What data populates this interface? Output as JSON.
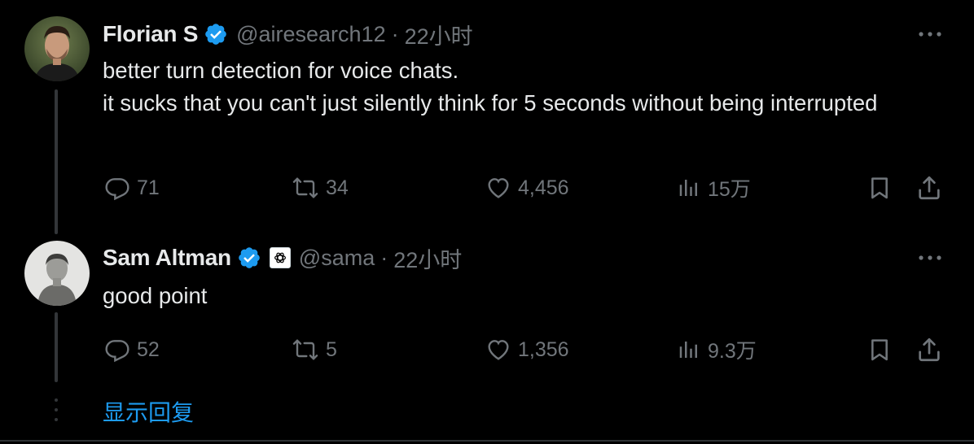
{
  "colors": {
    "background": "#000000",
    "text_primary": "#e7e9ea",
    "text_secondary": "#71767b",
    "accent_blue": "#1d9bf0",
    "thread_line": "#333639"
  },
  "tweets": [
    {
      "author": {
        "display_name": "Florian S",
        "handle": "@airesearch12",
        "verified": true,
        "avatar_icon": "avatar-photo"
      },
      "separator": "·",
      "time": "22小时",
      "text": "better turn detection for voice chats.\nit sucks that you can't just silently think for 5 seconds without being interrupted",
      "actions": {
        "replies": "71",
        "retweets": "34",
        "likes": "4,456",
        "views": "15万"
      }
    },
    {
      "author": {
        "display_name": "Sam Altman",
        "handle": "@sama",
        "verified": true,
        "affiliation_icon": "openai-logo-icon",
        "avatar_icon": "avatar-photo"
      },
      "separator": "·",
      "time": "22小时",
      "text": "good point",
      "actions": {
        "replies": "52",
        "retweets": "5",
        "likes": "1,356",
        "views": "9.3万"
      }
    }
  ],
  "show_replies_label": "显示回复",
  "icons": [
    "reply-icon",
    "retweet-icon",
    "like-icon",
    "views-icon",
    "bookmark-icon",
    "share-icon",
    "more-icon",
    "verified-badge-icon"
  ]
}
